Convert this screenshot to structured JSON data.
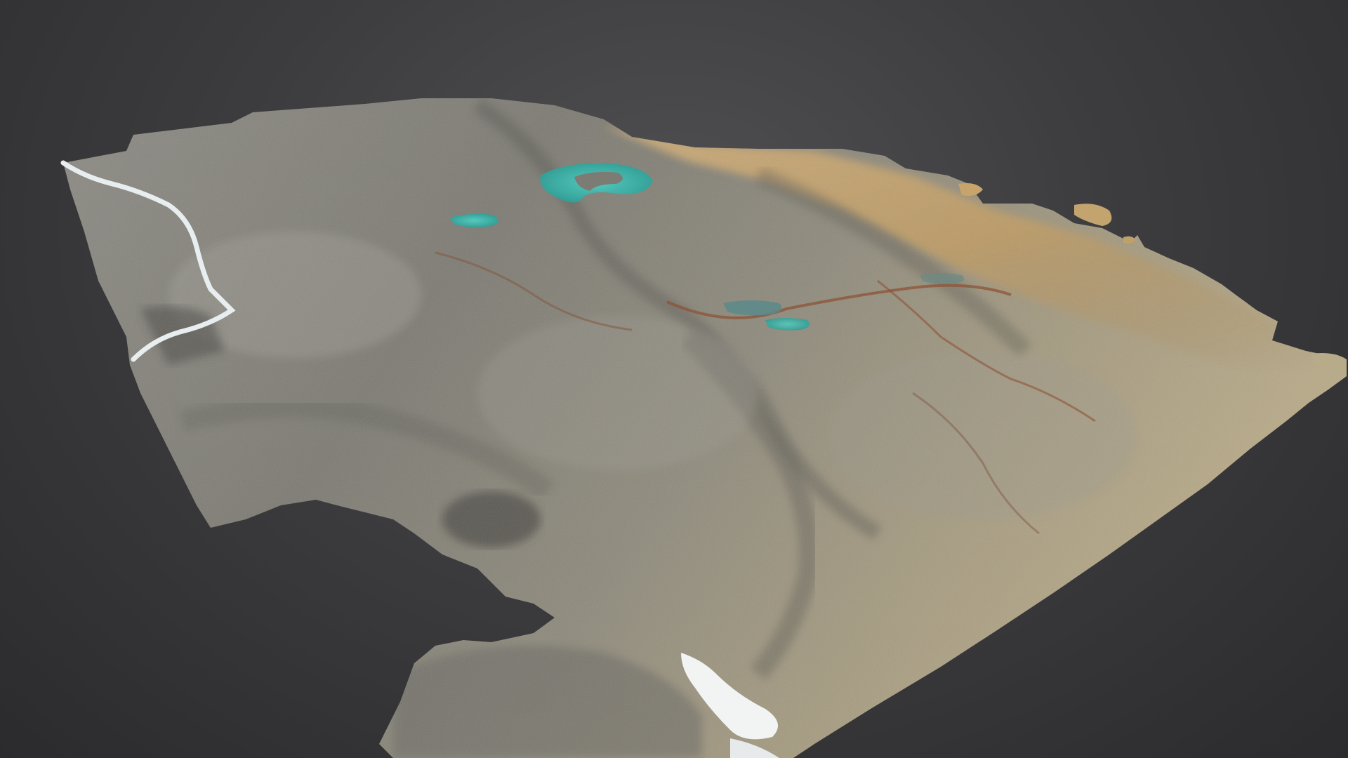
{
  "viewer": {
    "background_color": "#3d3d3f",
    "model": {
      "kind": "3d-terrain-mesh",
      "icon": "terrain-model-icon",
      "terrain_colors": {
        "rock_light": "#a19e94",
        "rock_mid": "#7e7c74",
        "rock_dark": "#55554f",
        "ochre_slope": "#c9a56a",
        "rust_stream": "#8a4a2a",
        "lake_turquoise": "#3fb2a8",
        "river_white": "#e8eef0",
        "snow_patch": "#f2f4f4"
      }
    }
  }
}
